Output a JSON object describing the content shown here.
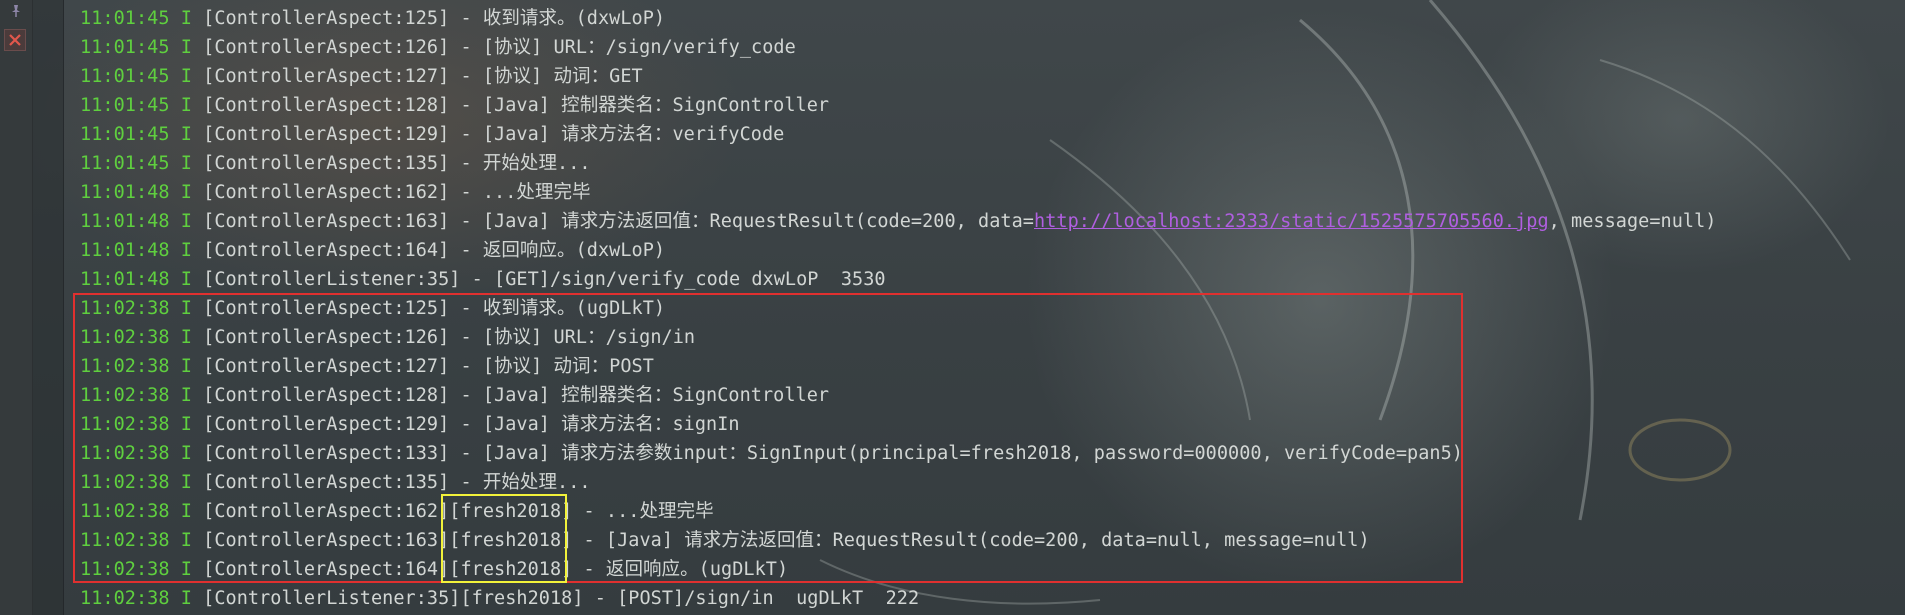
{
  "ui": {
    "colors": {
      "timestamp": "#5fcf3f",
      "text": "#d2d6d4",
      "link": "#b05fe0",
      "highlight_red": "#e0302f",
      "highlight_yellow": "#f2f23a"
    },
    "toolbar": {
      "pin_icon": "pin-icon",
      "close_icon": "close-icon"
    }
  },
  "log": [
    {
      "time": "11:01:45",
      "level": "I",
      "text": "[ControllerAspect:125] - 收到请求。(dxwLoP)"
    },
    {
      "time": "11:01:45",
      "level": "I",
      "text": "[ControllerAspect:126] - [协议] URL：/sign/verify_code"
    },
    {
      "time": "11:01:45",
      "level": "I",
      "text": "[ControllerAspect:127] - [协议] 动词：GET"
    },
    {
      "time": "11:01:45",
      "level": "I",
      "text": "[ControllerAspect:128] - [Java] 控制器类名：SignController"
    },
    {
      "time": "11:01:45",
      "level": "I",
      "text": "[ControllerAspect:129] - [Java] 请求方法名：verifyCode"
    },
    {
      "time": "11:01:45",
      "level": "I",
      "text": "[ControllerAspect:135] - 开始处理..."
    },
    {
      "time": "11:01:48",
      "level": "I",
      "text": "[ControllerAspect:162] - ...处理完毕"
    },
    {
      "time": "11:01:48",
      "level": "I",
      "text": "[ControllerAspect:163] - [Java] 请求方法返回值：RequestResult(code=200, data=",
      "link": "http://localhost:2333/static/1525575705560.jpg",
      "text_after": ", message=null)"
    },
    {
      "time": "11:01:48",
      "level": "I",
      "text": "[ControllerAspect:164] - 返回响应。(dxwLoP)"
    },
    {
      "time": "11:01:48",
      "level": "I",
      "text": "[ControllerListener:35] - [GET]/sign/verify_code dxwLoP  3530"
    },
    {
      "time": "11:02:38",
      "level": "I",
      "text": "[ControllerAspect:125] - 收到请求。(ugDLkT)"
    },
    {
      "time": "11:02:38",
      "level": "I",
      "text": "[ControllerAspect:126] - [协议] URL：/sign/in"
    },
    {
      "time": "11:02:38",
      "level": "I",
      "text": "[ControllerAspect:127] - [协议] 动词：POST"
    },
    {
      "time": "11:02:38",
      "level": "I",
      "text": "[ControllerAspect:128] - [Java] 控制器类名：SignController"
    },
    {
      "time": "11:02:38",
      "level": "I",
      "text": "[ControllerAspect:129] - [Java] 请求方法名：signIn"
    },
    {
      "time": "11:02:38",
      "level": "I",
      "text": "[ControllerAspect:133] - [Java] 请求方法参数input：SignInput(principal=fresh2018, password=000000, verifyCode=pan5)"
    },
    {
      "time": "11:02:38",
      "level": "I",
      "text": "[ControllerAspect:135] - 开始处理..."
    },
    {
      "time": "11:02:38",
      "level": "I",
      "text": "[ControllerAspect:162][fresh2018] - ...处理完毕"
    },
    {
      "time": "11:02:38",
      "level": "I",
      "text": "[ControllerAspect:163][fresh2018] - [Java] 请求方法返回值：RequestResult(code=200, data=null, message=null)"
    },
    {
      "time": "11:02:38",
      "level": "I",
      "text": "[ControllerAspect:164][fresh2018] - 返回响应。(ugDLkT)"
    },
    {
      "time": "11:02:38",
      "level": "I",
      "text": "[ControllerListener:35][fresh2018] - [POST]/sign/in  ugDLkT  222"
    }
  ]
}
